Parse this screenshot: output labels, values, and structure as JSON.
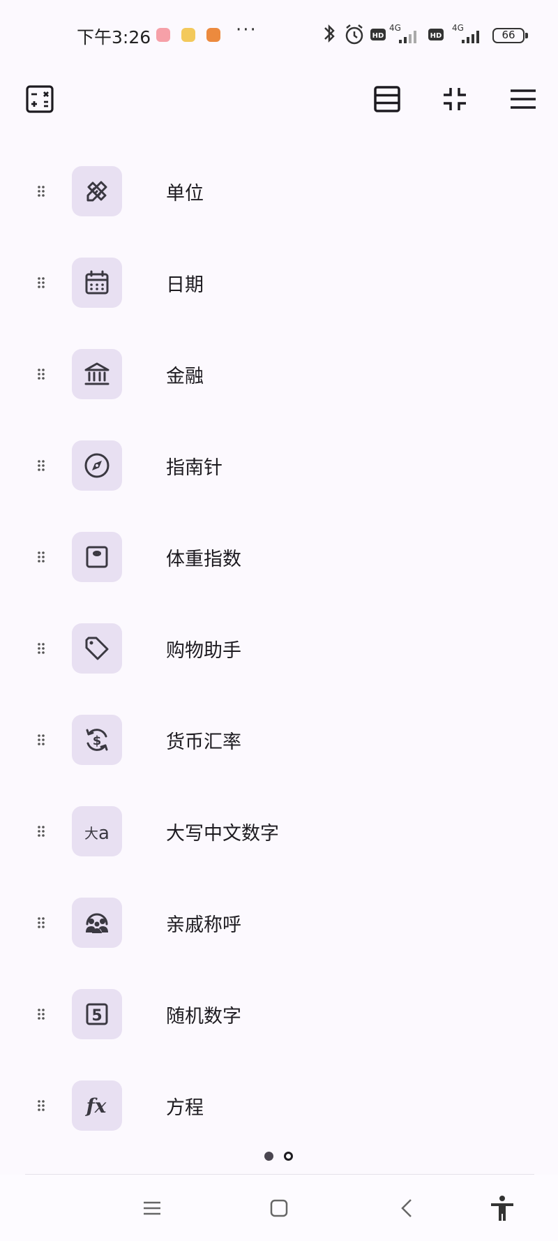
{
  "status_bar": {
    "time": "下午3:26",
    "battery": "66",
    "network1": "4G",
    "network2": "4G",
    "hd1": "HD",
    "hd2": "HD"
  },
  "toolbar": {
    "left_icon": "calculator-icon",
    "right_icons": [
      "list-view-icon",
      "collapse-icon",
      "menu-icon"
    ]
  },
  "tools": [
    {
      "label": "单位",
      "icon": "ruler-pencil-icon"
    },
    {
      "label": "日期",
      "icon": "calendar-icon"
    },
    {
      "label": "金融",
      "icon": "bank-icon"
    },
    {
      "label": "指南针",
      "icon": "compass-icon"
    },
    {
      "label": "体重指数",
      "icon": "scale-icon"
    },
    {
      "label": "购物助手",
      "icon": "tag-icon"
    },
    {
      "label": "货币汇率",
      "icon": "currency-exchange-icon"
    },
    {
      "label": "大写中文数字",
      "icon": "chinese-text-icon",
      "icon_text_big": "大",
      "icon_text_small": "a"
    },
    {
      "label": "亲戚称呼",
      "icon": "family-icon"
    },
    {
      "label": "随机数字",
      "icon": "random-number-icon",
      "icon_text": "5"
    },
    {
      "label": "方程",
      "icon": "function-icon",
      "icon_text": "fx"
    }
  ],
  "pager": {
    "pages": 2,
    "current": 1
  },
  "colors": {
    "background": "#fcf9fe",
    "icon_tile": "#e8e0f2",
    "icon_stroke": "#3a3841"
  }
}
